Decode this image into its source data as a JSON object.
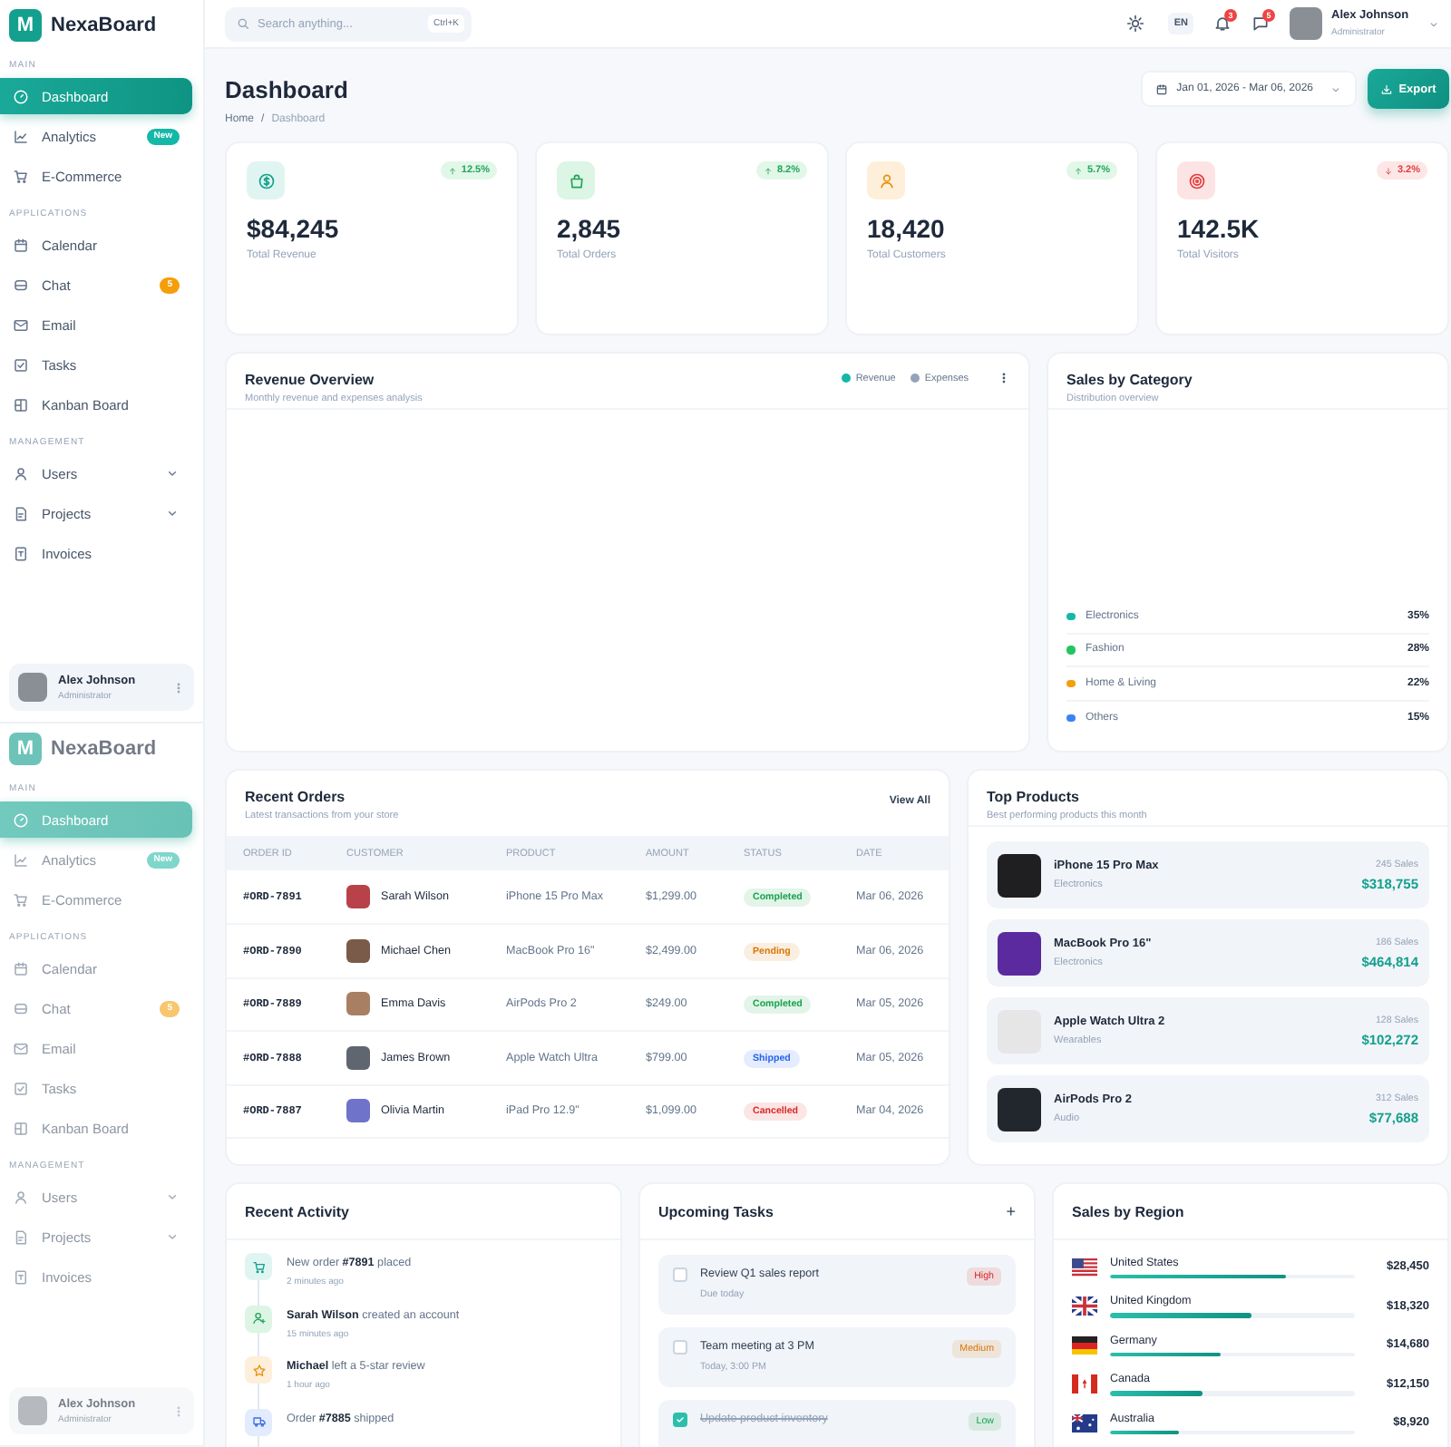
{
  "sidebars": [
    {
      "faded": false,
      "logo": {
        "mark": "M",
        "name": "NexaBoard"
      },
      "sections": [
        {
          "label": "MAIN",
          "items": [
            {
              "label": "Dashboard",
              "selected": true,
              "expandable": false
            },
            {
              "label": "Analytics",
              "selected": false,
              "expandable": false,
              "badge": {
                "text": "New",
                "color": "#14b8a6"
              }
            },
            {
              "label": "E-Commerce",
              "selected": false,
              "expandable": false
            }
          ]
        },
        {
          "label": "APPLICATIONS",
          "items": [
            {
              "label": "Calendar",
              "selected": false,
              "expandable": false
            },
            {
              "label": "Chat",
              "selected": false,
              "expandable": false,
              "badge": {
                "text": "5",
                "color": "#f59e0b"
              }
            },
            {
              "label": "Email",
              "selected": false,
              "expandable": false
            },
            {
              "label": "Tasks",
              "selected": false,
              "expandable": false
            },
            {
              "label": "Kanban Board",
              "selected": false,
              "expandable": false
            }
          ]
        },
        {
          "label": "MANAGEMENT",
          "items": [
            {
              "label": "Users",
              "selected": false,
              "expandable": true
            },
            {
              "label": "Projects",
              "selected": false,
              "expandable": true
            },
            {
              "label": "Invoices",
              "selected": false,
              "expandable": false
            }
          ]
        }
      ],
      "user": {
        "name": "Alex Johnson",
        "role": "Administrator"
      }
    },
    {
      "faded": true,
      "logo": {
        "mark": "M",
        "name": "NexaBoard"
      },
      "sections": [
        {
          "label": "MAIN",
          "items": [
            {
              "label": "Dashboard",
              "selected": true,
              "expandable": false
            },
            {
              "label": "Analytics",
              "selected": false,
              "expandable": false,
              "badge": {
                "text": "New",
                "color": "#7fd6cb"
              }
            },
            {
              "label": "E-Commerce",
              "selected": false,
              "expandable": false
            }
          ]
        },
        {
          "label": "APPLICATIONS",
          "items": [
            {
              "label": "Calendar",
              "selected": false,
              "expandable": false
            },
            {
              "label": "Chat",
              "selected": false,
              "expandable": false,
              "badge": {
                "text": "5",
                "color": "#f8c66d"
              }
            },
            {
              "label": "Email",
              "selected": false,
              "expandable": false
            },
            {
              "label": "Tasks",
              "selected": false,
              "expandable": false
            },
            {
              "label": "Kanban Board",
              "selected": false,
              "expandable": false
            }
          ]
        },
        {
          "label": "MANAGEMENT",
          "items": [
            {
              "label": "Users",
              "selected": false,
              "expandable": true
            },
            {
              "label": "Projects",
              "selected": false,
              "expandable": true
            },
            {
              "label": "Invoices",
              "selected": false,
              "expandable": false
            }
          ]
        }
      ],
      "user": {
        "name": "Alex Johnson",
        "role": "Administrator"
      }
    }
  ],
  "topbar": {
    "search": {
      "placeholder": "Search anything...",
      "shortcut": "Ctrl+K"
    },
    "language": "EN",
    "notifications": "3",
    "messages": "5",
    "user": {
      "name": "Alex Johnson",
      "role": "Administrator"
    }
  },
  "page": {
    "title": "Dashboard",
    "breadcrumb": [
      "Home",
      "Dashboard"
    ],
    "separator": "/",
    "date_range": "Jan 01, 2026 - Mar 06, 2026",
    "export": "Export"
  },
  "stats": [
    {
      "kind": "revenue",
      "value": "$84,245",
      "label": "Total Revenue",
      "change": "12.5%",
      "rising": true
    },
    {
      "kind": "orders",
      "value": "2,845",
      "label": "Total Orders",
      "change": "8.2%",
      "rising": true
    },
    {
      "kind": "customers",
      "value": "18,420",
      "label": "Total Customers",
      "change": "5.7%",
      "rising": true
    },
    {
      "kind": "visitors",
      "value": "142.5K",
      "label": "Total Visitors",
      "change": "3.2%",
      "rising": false
    }
  ],
  "revenue_overview": {
    "title": "Revenue Overview",
    "subtitle": "Monthly revenue and expenses analysis",
    "legend": [
      {
        "label": "Revenue",
        "color": "#14b8a6"
      },
      {
        "label": "Expenses",
        "color": "#94a3b8"
      }
    ]
  },
  "sales_by_category": {
    "title": "Sales by Category",
    "subtitle": "Distribution overview",
    "items": [
      {
        "label": "Electronics",
        "value": "35%",
        "color": "#14b8a6"
      },
      {
        "label": "Fashion",
        "value": "28%",
        "color": "#22c55e"
      },
      {
        "label": "Home & Living",
        "value": "22%",
        "color": "#f59e0b"
      },
      {
        "label": "Others",
        "value": "15%",
        "color": "#3b82f6"
      }
    ]
  },
  "recent_orders": {
    "title": "Recent Orders",
    "subtitle": "Latest transactions from your store",
    "action": "View All",
    "columns": [
      "ORDER ID",
      "CUSTOMER",
      "PRODUCT",
      "AMOUNT",
      "STATUS",
      "DATE"
    ],
    "rows": [
      {
        "id": "#ORD-7891",
        "customer": "Sarah Wilson",
        "product": "iPhone 15 Pro Max",
        "amount": "$1,299.00",
        "status": {
          "text": "Completed",
          "color": "#16a34a"
        },
        "date": "Mar 06, 2026"
      },
      {
        "id": "#ORD-7890",
        "customer": "Michael Chen",
        "product": "MacBook Pro 16\"",
        "amount": "$2,499.00",
        "status": {
          "text": "Pending",
          "color": "#d97706"
        },
        "date": "Mar 06, 2026"
      },
      {
        "id": "#ORD-7889",
        "customer": "Emma Davis",
        "product": "AirPods Pro 2",
        "amount": "$249.00",
        "status": {
          "text": "Completed",
          "color": "#16a34a"
        },
        "date": "Mar 05, 2026"
      },
      {
        "id": "#ORD-7888",
        "customer": "James Brown",
        "product": "Apple Watch Ultra",
        "amount": "$799.00",
        "status": {
          "text": "Shipped",
          "color": "#2563eb"
        },
        "date": "Mar 05, 2026"
      },
      {
        "id": "#ORD-7887",
        "customer": "Olivia Martin",
        "product": "iPad Pro 12.9\"",
        "amount": "$1,099.00",
        "status": {
          "text": "Cancelled",
          "color": "#dc2626"
        },
        "date": "Mar 04, 2026"
      }
    ]
  },
  "top_products": {
    "title": "Top Products",
    "subtitle": "Best performing products this month",
    "items": [
      {
        "name": "iPhone 15 Pro Max",
        "category": "Electronics",
        "sales": "245 Sales",
        "revenue": "$318,755"
      },
      {
        "name": "MacBook Pro 16\"",
        "category": "Electronics",
        "sales": "186 Sales",
        "revenue": "$464,814"
      },
      {
        "name": "Apple Watch Ultra 2",
        "category": "Wearables",
        "sales": "128 Sales",
        "revenue": "$102,272"
      },
      {
        "name": "AirPods Pro 2",
        "category": "Audio",
        "sales": "312 Sales",
        "revenue": "$77,688"
      }
    ]
  },
  "recent_activity": {
    "title": "Recent Activity",
    "items": [
      {
        "kind": "order",
        "text": "New order **#7891** placed",
        "time": "2 minutes ago"
      },
      {
        "kind": "account",
        "text": "**Sarah Wilson** created an account",
        "time": "15 minutes ago"
      },
      {
        "kind": "review",
        "text": "**Michael** left a 5-star review",
        "time": "1 hour ago"
      },
      {
        "kind": "shipping",
        "text": "Order **#7885** shipped"
      }
    ]
  },
  "upcoming_tasks": {
    "title": "Upcoming Tasks",
    "add": "+",
    "items": [
      {
        "title": "Review Q1 sales report",
        "due": "Due today",
        "priority": {
          "text": "High",
          "color": "#dc2626"
        },
        "checked": false
      },
      {
        "title": "Team meeting at 3 PM",
        "due": "Today, 3:00 PM",
        "priority": {
          "text": "Medium",
          "color": "#d97706"
        },
        "checked": false
      },
      {
        "title": "Update product inventory",
        "priority": {
          "text": "Low",
          "color": "#16a34a"
        },
        "checked": true
      }
    ]
  },
  "sales_by_region": {
    "title": "Sales by Region",
    "items": [
      {
        "country": "United States",
        "amount": "$28,450",
        "level": 0.72
      },
      {
        "country": "United Kingdom",
        "amount": "$18,320",
        "level": 0.58
      },
      {
        "country": "Germany",
        "amount": "$14,680",
        "level": 0.45
      },
      {
        "country": "Canada",
        "amount": "$12,150",
        "level": 0.38
      },
      {
        "country": "Australia",
        "amount": "$8,920",
        "level": 0.28
      }
    ]
  }
}
